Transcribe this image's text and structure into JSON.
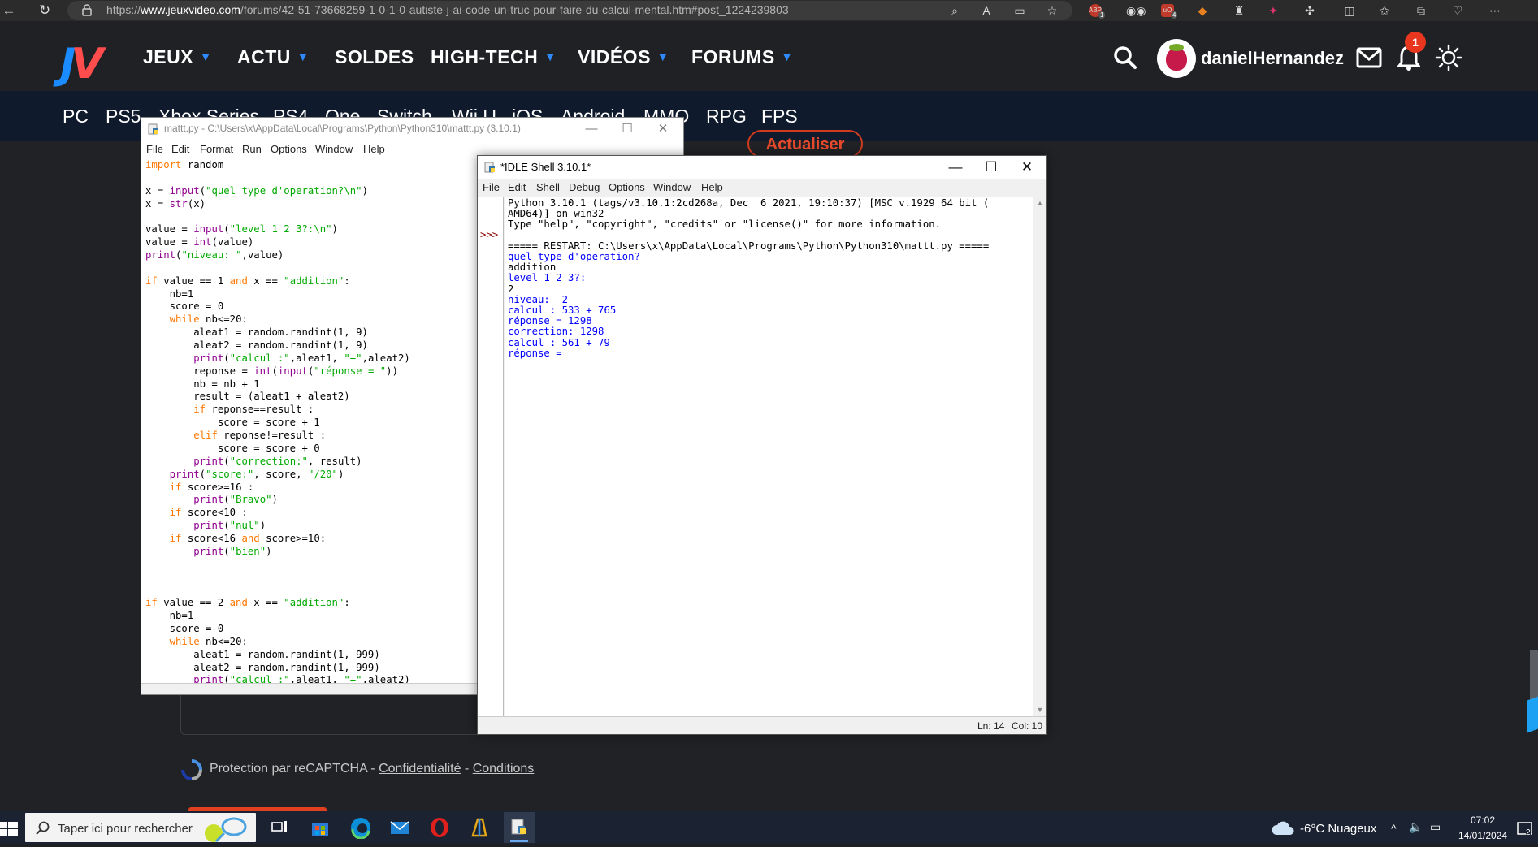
{
  "browser": {
    "url_prefix": "https://",
    "url_domain": "www.jeuxvideo.com",
    "url_path": "/forums/42-51-73668259-1-0-1-0-autiste-j-ai-code-un-truc-pour-faire-du-calcul-mental.htm#post_1224239803",
    "extension_badges": [
      "1",
      "4"
    ]
  },
  "site": {
    "menu": [
      "JEUX",
      "ACTU",
      "SOLDES",
      "HIGH-TECH",
      "VIDÉOS",
      "FORUMS"
    ],
    "username": "danielHernandez",
    "notification_count": "1",
    "platforms": [
      "PC",
      "PS5",
      "Xbox Series",
      "PS4",
      "One",
      "Switch",
      "Wii U",
      "iOS",
      "Android",
      "MMO",
      "RPG",
      "FPS"
    ],
    "refresh_button": "Actualiser",
    "recaptcha": {
      "prefix": "Protection par reCAPTCHA - ",
      "privacy": "Confidentialité",
      "sep": " - ",
      "terms": "Conditions"
    }
  },
  "editor": {
    "title": "mattt.py - C:\\Users\\x\\AppData\\Local\\Programs\\Python\\Python310\\mattt.py (3.10.1)",
    "menu": [
      "File",
      "Edit",
      "Format",
      "Run",
      "Options",
      "Window",
      "Help"
    ],
    "code": [
      [
        [
          "kw",
          "import"
        ],
        [
          "n",
          " random"
        ]
      ],
      [],
      [
        [
          "n",
          "x = "
        ],
        [
          "bi",
          "input"
        ],
        [
          "n",
          "("
        ],
        [
          "st",
          "\"quel type d'operation?\\n\""
        ],
        [
          "n",
          ")"
        ]
      ],
      [
        [
          "n",
          "x = "
        ],
        [
          "bi",
          "str"
        ],
        [
          "n",
          "(x)"
        ]
      ],
      [],
      [
        [
          "n",
          "value = "
        ],
        [
          "bi",
          "input"
        ],
        [
          "n",
          "("
        ],
        [
          "st",
          "\"level 1 2 3?:\\n\""
        ],
        [
          "n",
          ")"
        ]
      ],
      [
        [
          "n",
          "value = "
        ],
        [
          "bi",
          "int"
        ],
        [
          "n",
          "(value)"
        ]
      ],
      [
        [
          "bi",
          "print"
        ],
        [
          "n",
          "("
        ],
        [
          "st",
          "\"niveau: \""
        ],
        [
          "n",
          ",value)"
        ]
      ],
      [],
      [
        [
          "kw",
          "if"
        ],
        [
          "n",
          " value == 1 "
        ],
        [
          "kw",
          "and"
        ],
        [
          "n",
          " x == "
        ],
        [
          "st",
          "\"addition\""
        ],
        [
          "n",
          ":"
        ]
      ],
      [
        [
          "n",
          "    nb=1"
        ]
      ],
      [
        [
          "n",
          "    score = 0"
        ]
      ],
      [
        [
          "n",
          "    "
        ],
        [
          "kw",
          "while"
        ],
        [
          "n",
          " nb<=20:"
        ]
      ],
      [
        [
          "n",
          "        aleat1 = random.randint(1, 9)"
        ]
      ],
      [
        [
          "n",
          "        aleat2 = random.randint(1, 9)"
        ]
      ],
      [
        [
          "n",
          "        "
        ],
        [
          "bi",
          "print"
        ],
        [
          "n",
          "("
        ],
        [
          "st",
          "\"calcul :\""
        ],
        [
          "n",
          ",aleat1, "
        ],
        [
          "st",
          "\"+\""
        ],
        [
          "n",
          ",aleat2)"
        ]
      ],
      [
        [
          "n",
          "        reponse = "
        ],
        [
          "bi",
          "int"
        ],
        [
          "n",
          "("
        ],
        [
          "bi",
          "input"
        ],
        [
          "n",
          "("
        ],
        [
          "st",
          "\"réponse = \""
        ],
        [
          "n",
          "))"
        ]
      ],
      [
        [
          "n",
          "        nb = nb + 1"
        ]
      ],
      [
        [
          "n",
          "        result = (aleat1 + aleat2)"
        ]
      ],
      [
        [
          "n",
          "        "
        ],
        [
          "kw",
          "if"
        ],
        [
          "n",
          " reponse==result :"
        ]
      ],
      [
        [
          "n",
          "            score = score + 1"
        ]
      ],
      [
        [
          "n",
          "        "
        ],
        [
          "kw",
          "elif"
        ],
        [
          "n",
          " reponse!=result :"
        ]
      ],
      [
        [
          "n",
          "            score = score + 0"
        ]
      ],
      [
        [
          "n",
          "        "
        ],
        [
          "bi",
          "print"
        ],
        [
          "n",
          "("
        ],
        [
          "st",
          "\"correction:\""
        ],
        [
          "n",
          ", result)"
        ]
      ],
      [
        [
          "n",
          "    "
        ],
        [
          "bi",
          "print"
        ],
        [
          "n",
          "("
        ],
        [
          "st",
          "\"score:\""
        ],
        [
          "n",
          ", score, "
        ],
        [
          "st",
          "\"/20\""
        ],
        [
          "n",
          ")"
        ]
      ],
      [
        [
          "n",
          "    "
        ],
        [
          "kw",
          "if"
        ],
        [
          "n",
          " score>=16 :"
        ]
      ],
      [
        [
          "n",
          "        "
        ],
        [
          "bi",
          "print"
        ],
        [
          "n",
          "("
        ],
        [
          "st",
          "\"Bravo\""
        ],
        [
          "n",
          ")"
        ]
      ],
      [
        [
          "n",
          "    "
        ],
        [
          "kw",
          "if"
        ],
        [
          "n",
          " score<10 :"
        ]
      ],
      [
        [
          "n",
          "        "
        ],
        [
          "bi",
          "print"
        ],
        [
          "n",
          "("
        ],
        [
          "st",
          "\"nul\""
        ],
        [
          "n",
          ")"
        ]
      ],
      [
        [
          "n",
          "    "
        ],
        [
          "kw",
          "if"
        ],
        [
          "n",
          " score<16 "
        ],
        [
          "kw",
          "and"
        ],
        [
          "n",
          " score>=10:"
        ]
      ],
      [
        [
          "n",
          "        "
        ],
        [
          "bi",
          "print"
        ],
        [
          "n",
          "("
        ],
        [
          "st",
          "\"bien\""
        ],
        [
          "n",
          ")"
        ]
      ],
      [],
      [],
      [],
      [
        [
          "kw",
          "if"
        ],
        [
          "n",
          " value == 2 "
        ],
        [
          "kw",
          "and"
        ],
        [
          "n",
          " x == "
        ],
        [
          "st",
          "\"addition\""
        ],
        [
          "n",
          ":"
        ]
      ],
      [
        [
          "n",
          "    nb=1"
        ]
      ],
      [
        [
          "n",
          "    score = 0"
        ]
      ],
      [
        [
          "n",
          "    "
        ],
        [
          "kw",
          "while"
        ],
        [
          "n",
          " nb<=20:"
        ]
      ],
      [
        [
          "n",
          "        aleat1 = random.randint(1, 999)"
        ]
      ],
      [
        [
          "n",
          "        aleat2 = random.randint(1, 999)"
        ]
      ],
      [
        [
          "n",
          "        "
        ],
        [
          "bi",
          "print"
        ],
        [
          "n",
          "("
        ],
        [
          "st",
          "\"calcul :\""
        ],
        [
          "n",
          ",aleat1, "
        ],
        [
          "st",
          "\"+\""
        ],
        [
          "n",
          ",aleat2)"
        ]
      ]
    ]
  },
  "shell": {
    "title": "*IDLE Shell 3.10.1*",
    "menu": [
      "File",
      "Edit",
      "Shell",
      "Debug",
      "Options",
      "Window",
      "Help"
    ],
    "prompt": ">>>",
    "lines": [
      [
        "n",
        "Python 3.10.1 (tags/v3.10.1:2cd268a, Dec  6 2021, 19:10:37) [MSC v.1929 64 bit ("
      ],
      [
        "n",
        "AMD64)] on win32"
      ],
      [
        "n",
        "Type \"help\", \"copyright\", \"credits\" or \"license()\" for more information."
      ],
      [
        "n",
        ""
      ],
      [
        "n",
        "===== RESTART: C:\\Users\\x\\AppData\\Local\\Programs\\Python\\Python310\\mattt.py ====="
      ],
      [
        "o",
        "quel type d'operation?"
      ],
      [
        "n",
        "addition"
      ],
      [
        "o",
        "level 1 2 3?:"
      ],
      [
        "n",
        "2"
      ],
      [
        "o",
        "niveau:  2"
      ],
      [
        "o",
        "calcul : 533 + 765"
      ],
      [
        "o",
        "réponse = 1298"
      ],
      [
        "o",
        "correction: 1298"
      ],
      [
        "o",
        "calcul : 561 + 79"
      ],
      [
        "o",
        "réponse = "
      ]
    ],
    "status_ln": "Ln: 14",
    "status_col": "Col: 10"
  },
  "taskbar": {
    "search_placeholder": "Taper ici pour rechercher",
    "weather": "-6°C  Nuageux",
    "time": "07:02",
    "date": "14/01/2024",
    "notif": "2"
  }
}
